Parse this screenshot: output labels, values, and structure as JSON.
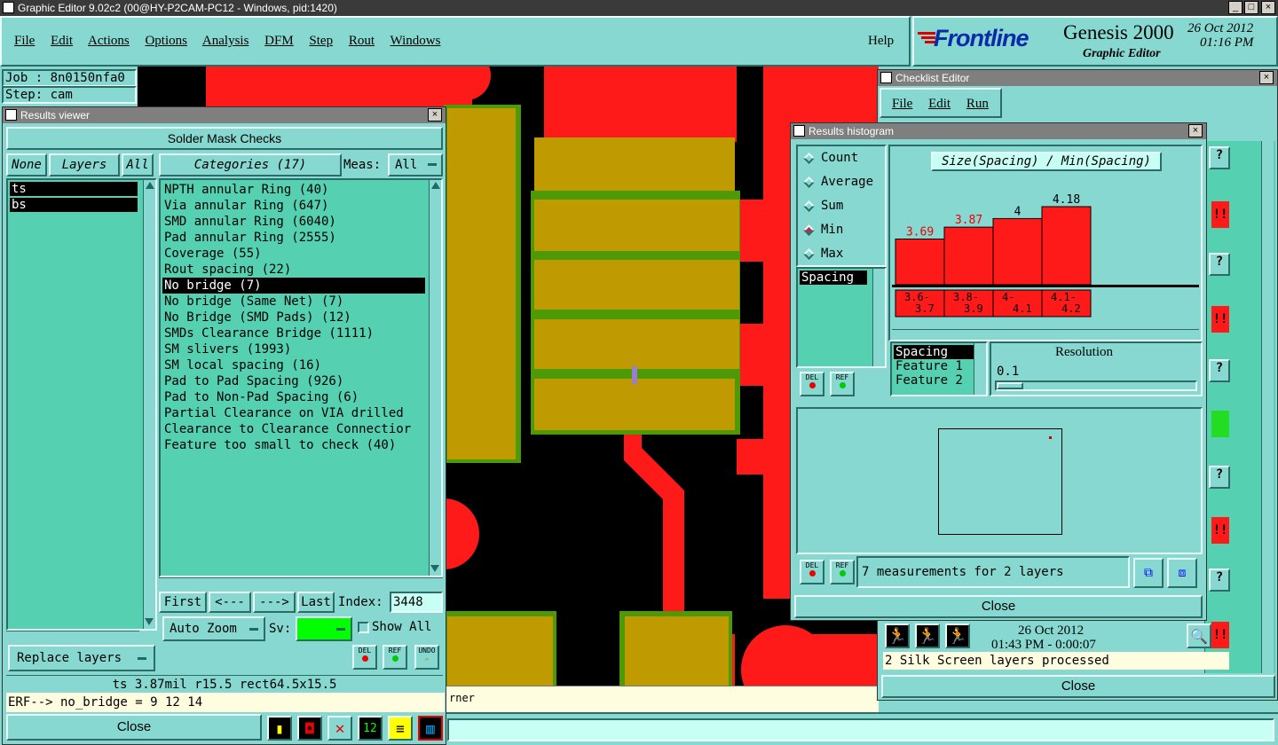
{
  "window": {
    "title": "Graphic Editor 9.02c2 (00@HY-P2CAM-PC12 - Windows, pid:1420)"
  },
  "menu": {
    "items": [
      "File",
      "Edit",
      "Actions",
      "Options",
      "Analysis",
      "DFM",
      "Step",
      "Rout",
      "Windows"
    ],
    "help": "Help"
  },
  "brand": {
    "logo": "Frontline",
    "product": "Genesis 2000",
    "subtitle": "Graphic Editor",
    "date": "26 Oct 2012",
    "time": "01:16 PM"
  },
  "job": {
    "job": "Job : 8n0150nfa0",
    "step": "Step: cam"
  },
  "results_viewer": {
    "title": "Results viewer",
    "heading": "Solder Mask Checks",
    "none": "None",
    "layers": "Layers",
    "all": "All",
    "layer_list": [
      "ts",
      "bs"
    ],
    "categories_label": "Categories (17)",
    "meas_label": "Meas:",
    "meas_value": "All",
    "categories": [
      "NPTH annular Ring (40)",
      "Via annular Ring (647)",
      "SMD annular Ring (6040)",
      "Pad annular Ring (2555)",
      "Coverage (55)",
      "Rout spacing (22)",
      "No bridge (7)",
      "No bridge (Same Net) (7)",
      "No Bridge (SMD Pads) (12)",
      "SMDs Clearance Bridge (1111)",
      "SM slivers (1993)",
      "SM local spacing (16)",
      "Pad to Pad Spacing (926)",
      "Pad to Non-Pad Spacing (6)",
      "Partial Clearance on VIA drilled",
      "Clearance to Clearance Connectior",
      "Feature too small to check (40)"
    ],
    "selected_category": "No bridge (7)",
    "first": "First",
    "prev": "<---",
    "next": "--->",
    "last": "Last",
    "index_label": "Index:",
    "index_value": "3448",
    "auto_zoom": "Auto Zoom",
    "sv_label": "Sv:",
    "show_all": "Show All",
    "replace_layers": "Replace layers",
    "del": "DEL",
    "ref": "REF",
    "undo": "UNDO",
    "info": "ts 3.87mil  r15.5  rect64.5x15.5",
    "erf": "ERF--> no_bridge = 9 12 14",
    "close": "Close"
  },
  "status_partial": "rner",
  "histogram": {
    "title": "Results histogram",
    "modes": [
      "Count",
      "Average",
      "Sum",
      "Min",
      "Max"
    ],
    "selected_mode": "Min",
    "chart_title": "Size(Spacing) / Min(Spacing)",
    "bars": [
      {
        "label": "3.69",
        "bin": "3.6-3.7",
        "value": 3.69
      },
      {
        "label": "3.87",
        "bin": "3.8-3.9",
        "value": 3.87
      },
      {
        "label": "4",
        "bin": "4-4.1",
        "value": 4
      },
      {
        "label": "4.18",
        "bin": "4.1-4.2",
        "value": 4.18
      }
    ],
    "bin_lines": [
      [
        "3.6-",
        "3.7"
      ],
      [
        "3.8-",
        "3.9"
      ],
      [
        "4-",
        "4.1"
      ],
      [
        "4.1-",
        "4.2"
      ]
    ],
    "list_item": "Spacing",
    "attr_list": [
      "Spacing",
      "Feature 1",
      "Feature 2"
    ],
    "resolution_label": "Resolution",
    "resolution_value": "0.1",
    "del": "DEL",
    "ref": "REF",
    "measurements": "7 measurements for 2 layers",
    "close": "Close"
  },
  "checklist": {
    "title": "Checklist Editor",
    "menu": [
      "File",
      "Edit",
      "Run"
    ],
    "date": "26 Oct 2012",
    "time": "01:43 PM - 0:00:07",
    "status": "2 Silk Screen layers processed",
    "close": "Close"
  },
  "colors": {
    "copper": "#ff1a1a",
    "mask": "#bf9a00",
    "mask_edge": "#4e9a06",
    "ui_bg": "#86d8d0",
    "list_bg": "#55d0b0"
  }
}
